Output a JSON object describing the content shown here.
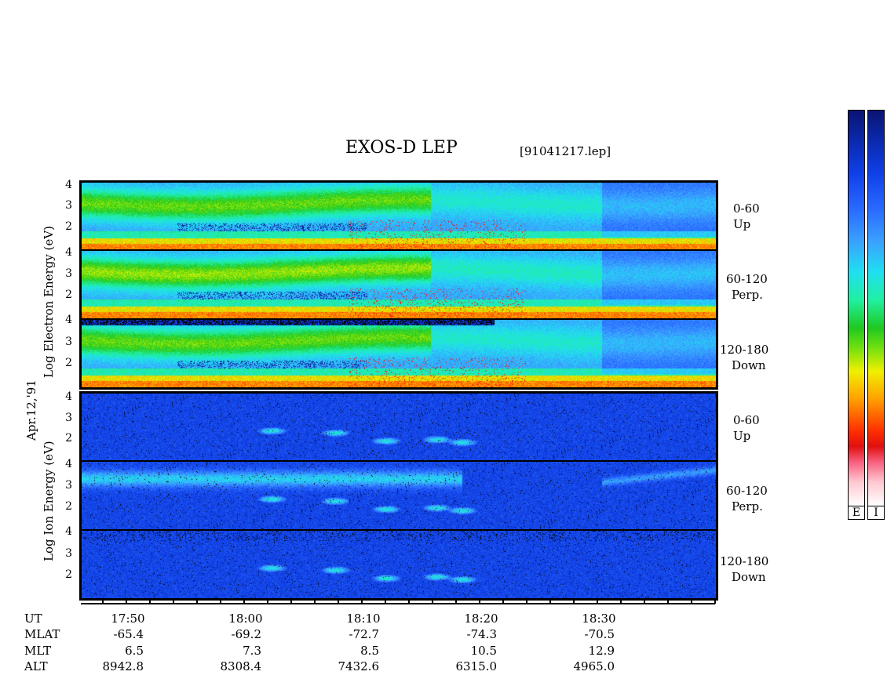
{
  "chart_data": {
    "type": "heatmap",
    "title": "EXOS-D LEP",
    "file_label": "[91041217.lep]",
    "date_label": "Apr.12,'91",
    "groups": [
      {
        "ylabel": "Log  Electron  Energy (eV)",
        "panels": [
          {
            "pitch": "0-60",
            "dir": "Up",
            "yticks": [
              "4",
              "3",
              "2"
            ]
          },
          {
            "pitch": "60-120",
            "dir": "Perp.",
            "yticks": [
              "4",
              "3",
              "2"
            ]
          },
          {
            "pitch": "120-180",
            "dir": "Down",
            "yticks": [
              "4",
              "3",
              "2"
            ]
          }
        ]
      },
      {
        "ylabel": "Log  Ion  Energy (eV)",
        "panels": [
          {
            "pitch": "0-60",
            "dir": "Up",
            "yticks": [
              "4",
              "3",
              "2"
            ]
          },
          {
            "pitch": "60-120",
            "dir": "Perp.",
            "yticks": [
              "4",
              "3",
              "2"
            ]
          },
          {
            "pitch": "120-180",
            "dir": "Down",
            "yticks": [
              "4",
              "3",
              "2"
            ]
          }
        ]
      }
    ],
    "ylim": [
      1,
      4
    ],
    "xaxis": {
      "row_labels": [
        "UT",
        "MLAT",
        "MLT",
        "ALT"
      ],
      "ticks": [
        {
          "UT": "17:50",
          "MLAT": "-65.4",
          "MLT": "6.5",
          "ALT": "8942.8"
        },
        {
          "UT": "18:00",
          "MLAT": "-69.2",
          "MLT": "7.3",
          "ALT": "8308.4"
        },
        {
          "UT": "18:10",
          "MLAT": "-72.7",
          "MLT": "8.5",
          "ALT": "7432.6"
        },
        {
          "UT": "18:20",
          "MLAT": "-74.3",
          "MLT": "10.5",
          "ALT": "6315.0"
        },
        {
          "UT": "18:30",
          "MLAT": "-70.5",
          "MLT": "12.9",
          "ALT": "4965.0"
        }
      ]
    },
    "colorbars": [
      {
        "label": "E"
      },
      {
        "label": "I"
      }
    ]
  }
}
